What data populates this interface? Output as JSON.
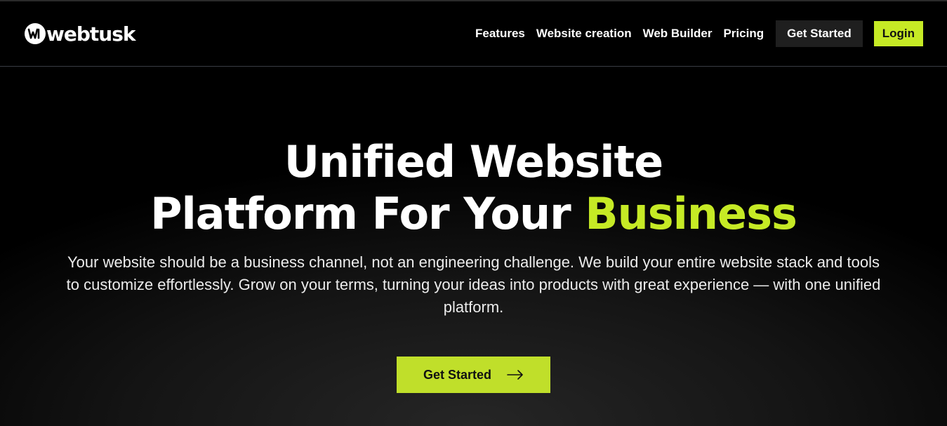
{
  "brand": {
    "name": "webtusk",
    "logo_icon": "webtusk-logo-icon"
  },
  "nav": {
    "links": [
      "Features",
      "Website creation",
      "Web Builder",
      "Pricing"
    ],
    "get_started_label": "Get Started",
    "login_label": "Login"
  },
  "hero": {
    "title_line1": "Unified Website",
    "title_line2_prefix": "Platform For Your",
    "title_line2_accent": "Business",
    "subtitle": "Your website should be a business channel, not an engineering challenge. We build your entire website stack and tools to customize effortlessly. Grow on your terms, turning your ideas into products with great experience — with one unified platform.",
    "cta_label": "Get Started",
    "cta_icon": "arrow-right-icon"
  },
  "colors": {
    "accent": "#c6ea25",
    "background": "#000000",
    "nav_button_bg": "#1f1f1f"
  }
}
